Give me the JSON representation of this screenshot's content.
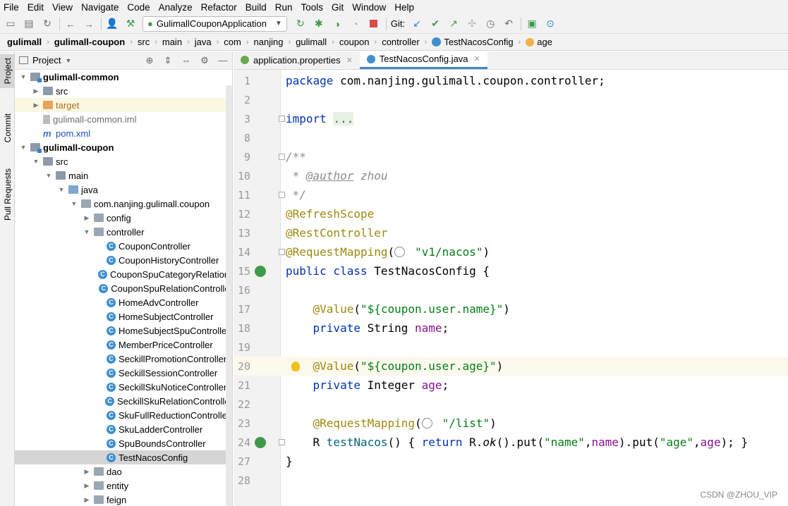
{
  "menu": [
    "File",
    "Edit",
    "View",
    "Navigate",
    "Code",
    "Analyze",
    "Refactor",
    "Build",
    "Run",
    "Tools",
    "Git",
    "Window",
    "Help"
  ],
  "toolbar": {
    "run_config": "GulimallCouponApplication",
    "git_label": "Git:"
  },
  "breadcrumb": [
    "gulimall",
    "gulimall-coupon",
    "src",
    "main",
    "java",
    "com",
    "nanjing",
    "gulimall",
    "coupon",
    "controller",
    "TestNacosConfig",
    "age"
  ],
  "side_tabs": [
    "Project",
    "Commit",
    "Pull Requests"
  ],
  "project": {
    "title": "Project",
    "tree": [
      {
        "label": "gulimall-common",
        "depth": 1,
        "icon": "module",
        "arrow": "down",
        "bold": true
      },
      {
        "label": "src",
        "depth": 2,
        "icon": "folder",
        "arrow": "right"
      },
      {
        "label": "target",
        "depth": 2,
        "icon": "target",
        "arrow": "right",
        "highlight": true
      },
      {
        "label": "gulimall-common.iml",
        "depth": 2,
        "icon": "iml",
        "color": "#6e6e6e"
      },
      {
        "label": "pom.xml",
        "depth": 2,
        "icon": "maven",
        "color": "#1d4fb5"
      },
      {
        "label": "gulimall-coupon",
        "depth": 1,
        "icon": "module",
        "arrow": "down",
        "bold": true
      },
      {
        "label": "src",
        "depth": 2,
        "icon": "folder",
        "arrow": "down"
      },
      {
        "label": "main",
        "depth": 3,
        "icon": "folder",
        "arrow": "down"
      },
      {
        "label": "java",
        "depth": 4,
        "icon": "src",
        "arrow": "down"
      },
      {
        "label": "com.nanjing.gulimall.coupon",
        "depth": 5,
        "icon": "pkg",
        "arrow": "down"
      },
      {
        "label": "config",
        "depth": 6,
        "icon": "pkg",
        "arrow": "right"
      },
      {
        "label": "controller",
        "depth": 6,
        "icon": "pkg",
        "arrow": "down"
      },
      {
        "label": "CouponController",
        "depth": 7,
        "icon": "class"
      },
      {
        "label": "CouponHistoryController",
        "depth": 7,
        "icon": "class"
      },
      {
        "label": "CouponSpuCategoryRelationController",
        "depth": 7,
        "icon": "class"
      },
      {
        "label": "CouponSpuRelationController",
        "depth": 7,
        "icon": "class"
      },
      {
        "label": "HomeAdvController",
        "depth": 7,
        "icon": "class"
      },
      {
        "label": "HomeSubjectController",
        "depth": 7,
        "icon": "class"
      },
      {
        "label": "HomeSubjectSpuController",
        "depth": 7,
        "icon": "class"
      },
      {
        "label": "MemberPriceController",
        "depth": 7,
        "icon": "class"
      },
      {
        "label": "SeckillPromotionController",
        "depth": 7,
        "icon": "class"
      },
      {
        "label": "SeckillSessionController",
        "depth": 7,
        "icon": "class"
      },
      {
        "label": "SeckillSkuNoticeController",
        "depth": 7,
        "icon": "class"
      },
      {
        "label": "SeckillSkuRelationController",
        "depth": 7,
        "icon": "class"
      },
      {
        "label": "SkuFullReductionController",
        "depth": 7,
        "icon": "class"
      },
      {
        "label": "SkuLadderController",
        "depth": 7,
        "icon": "class"
      },
      {
        "label": "SpuBoundsController",
        "depth": 7,
        "icon": "class"
      },
      {
        "label": "TestNacosConfig",
        "depth": 7,
        "icon": "class",
        "selected": true
      },
      {
        "label": "dao",
        "depth": 6,
        "icon": "pkg",
        "arrow": "right"
      },
      {
        "label": "entity",
        "depth": 6,
        "icon": "pkg",
        "arrow": "right"
      },
      {
        "label": "feign",
        "depth": 6,
        "icon": "pkg",
        "arrow": "right"
      }
    ]
  },
  "editor_tabs": [
    {
      "label": "application.properties",
      "active": false
    },
    {
      "label": "TestNacosConfig.java",
      "active": true
    }
  ],
  "code": [
    {
      "ln": "1",
      "parts": [
        [
          "kw",
          "package "
        ],
        [
          "",
          "com.nanjing.gulimall.coupon.controller;"
        ]
      ]
    },
    {
      "ln": "2",
      "parts": []
    },
    {
      "ln": "3",
      "parts": [
        [
          "kw",
          "import "
        ],
        [
          "fold",
          "..."
        ]
      ]
    },
    {
      "ln": "8",
      "parts": []
    },
    {
      "ln": "9",
      "parts": [
        [
          "cm",
          "/**"
        ]
      ]
    },
    {
      "ln": "10",
      "parts": [
        [
          "cm",
          " * "
        ],
        [
          "cmref",
          "@author"
        ],
        [
          "cm",
          " zhou"
        ]
      ]
    },
    {
      "ln": "11",
      "parts": [
        [
          "cm",
          " */"
        ]
      ]
    },
    {
      "ln": "12",
      "parts": [
        [
          "an",
          "@RefreshScope"
        ]
      ]
    },
    {
      "ln": "13",
      "parts": [
        [
          "an",
          "@RestController"
        ]
      ]
    },
    {
      "ln": "14",
      "parts": [
        [
          "an",
          "@RequestMapping"
        ],
        [
          "",
          "("
        ],
        [
          "globe",
          ""
        ],
        [
          "st",
          "\"v1/nacos\""
        ],
        [
          "",
          ")"
        ]
      ]
    },
    {
      "ln": "15",
      "parts": [
        [
          "kw",
          "public class "
        ],
        [
          "",
          "TestNacosConfig {"
        ]
      ]
    },
    {
      "ln": "16",
      "parts": []
    },
    {
      "ln": "17",
      "parts": [
        [
          "",
          "    "
        ],
        [
          "an",
          "@Value"
        ],
        [
          "",
          "("
        ],
        [
          "st",
          "\"${coupon.user.name}\""
        ],
        [
          "",
          ")"
        ]
      ]
    },
    {
      "ln": "18",
      "parts": [
        [
          "",
          "    "
        ],
        [
          "kw",
          "private "
        ],
        [
          "",
          "String "
        ],
        [
          "fd",
          "name"
        ],
        [
          "",
          ";"
        ]
      ]
    },
    {
      "ln": "19",
      "parts": []
    },
    {
      "ln": "20",
      "parts": [
        [
          "",
          "    "
        ],
        [
          "an",
          "@Value"
        ],
        [
          "",
          "("
        ],
        [
          "st",
          "\"${coupon.user.age}\""
        ],
        [
          "",
          ")"
        ]
      ]
    },
    {
      "ln": "21",
      "parts": [
        [
          "",
          "    "
        ],
        [
          "kw",
          "private "
        ],
        [
          "",
          "Integer "
        ],
        [
          "fd",
          "age"
        ],
        [
          "",
          ";"
        ]
      ]
    },
    {
      "ln": "22",
      "parts": []
    },
    {
      "ln": "23",
      "parts": [
        [
          "",
          "    "
        ],
        [
          "an",
          "@RequestMapping"
        ],
        [
          "",
          "("
        ],
        [
          "globe",
          ""
        ],
        [
          "st",
          "\"/list\""
        ],
        [
          "",
          ")"
        ]
      ]
    },
    {
      "ln": "24",
      "parts": [
        [
          "",
          "    R "
        ],
        [
          "mt",
          "testNacos"
        ],
        [
          "",
          "() { "
        ],
        [
          "kw",
          "return "
        ],
        [
          "",
          "R."
        ],
        [
          "it",
          "ok"
        ],
        [
          "",
          "().put("
        ],
        [
          "st",
          "\"name\""
        ],
        [
          "",
          ","
        ],
        [
          "fd",
          "name"
        ],
        [
          "",
          ")."
        ],
        [
          "",
          "put"
        ],
        [
          "",
          "("
        ],
        [
          "st",
          "\"age\""
        ],
        [
          "",
          ","
        ],
        [
          "fd",
          "age"
        ],
        [
          "",
          "); }"
        ]
      ]
    },
    {
      "ln": "27",
      "parts": [
        [
          "",
          "}"
        ]
      ]
    },
    {
      "ln": "28",
      "parts": []
    }
  ],
  "watermark": "CSDN @ZHOU_VIP"
}
